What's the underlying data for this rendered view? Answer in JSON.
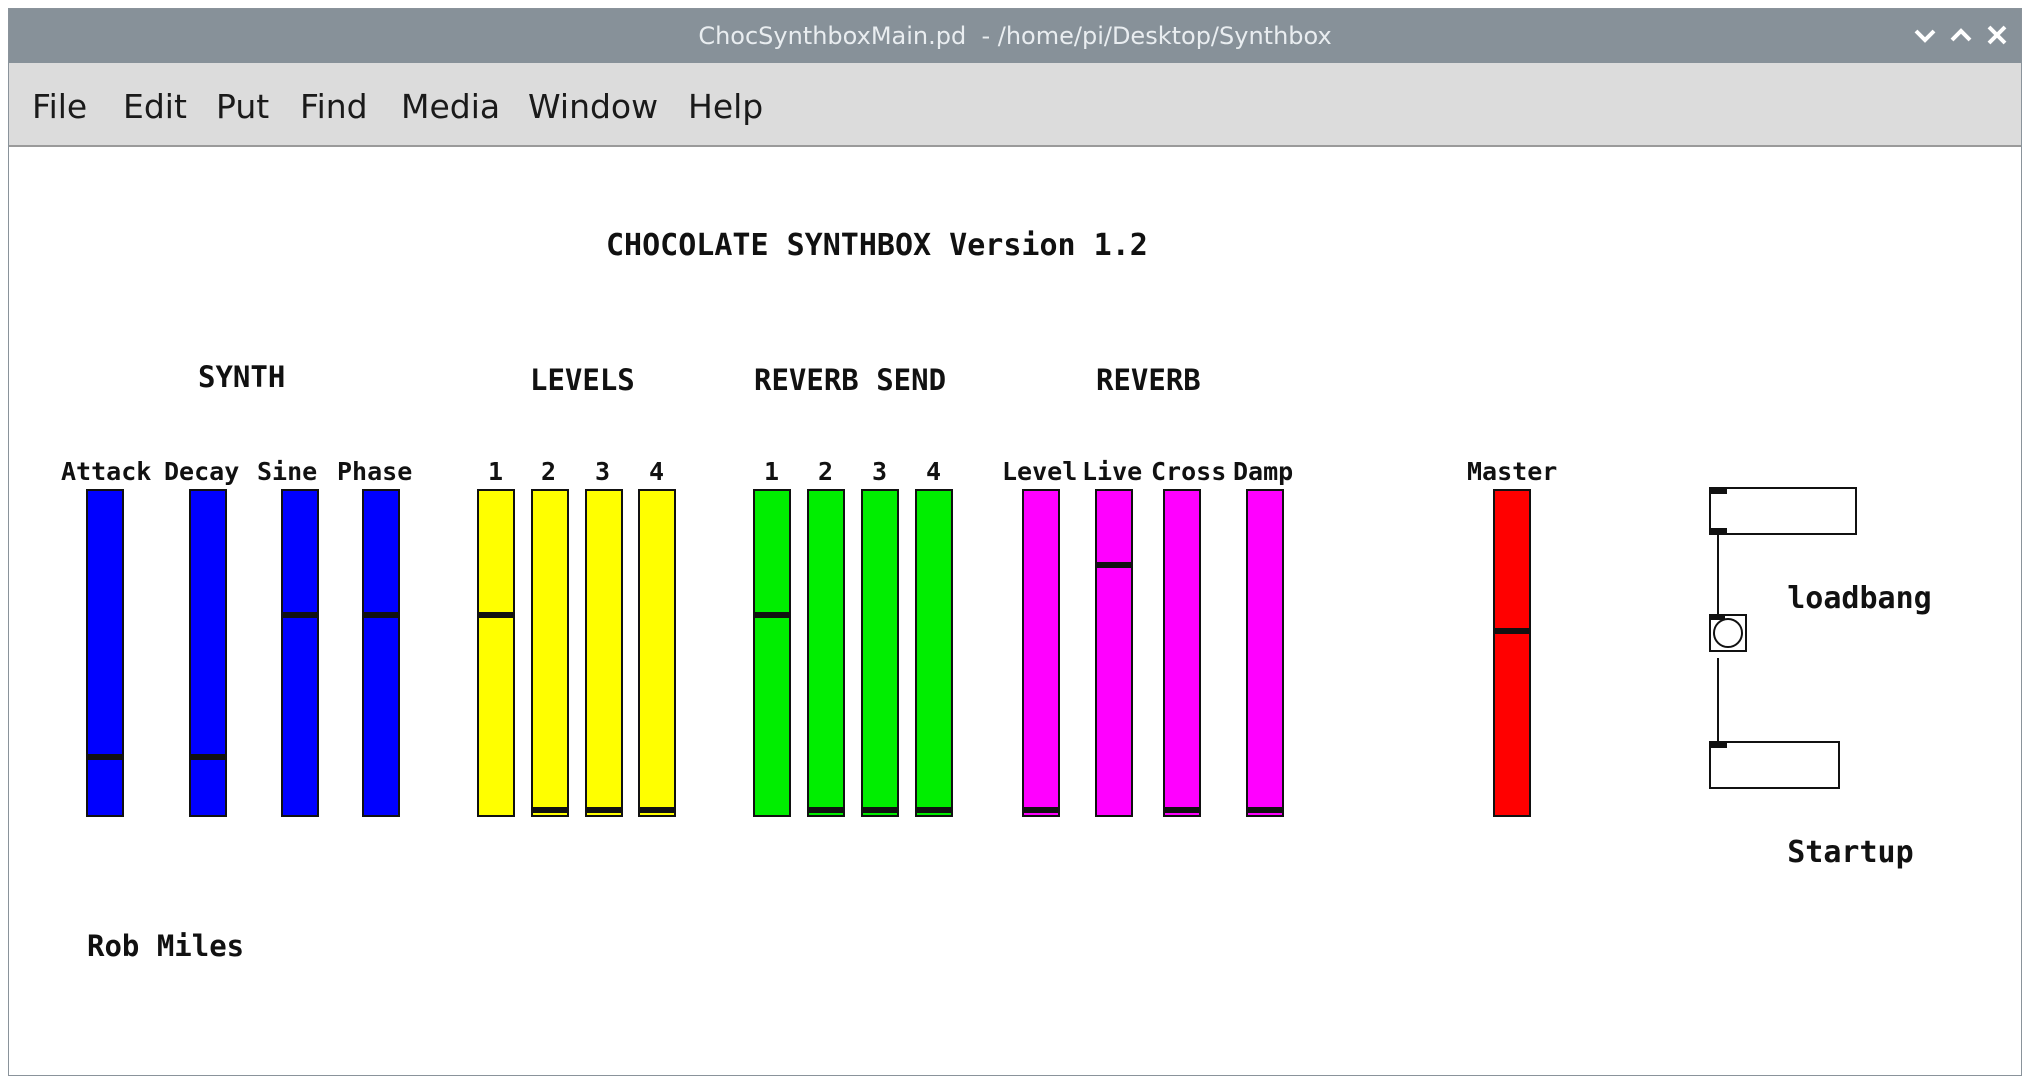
{
  "window": {
    "title": "ChocSynthboxMain.pd  - /home/pi/Desktop/Synthbox",
    "controls": [
      "chevron-down-icon",
      "chevron-up-icon",
      "close-icon"
    ],
    "titlebar_color": "#879199"
  },
  "menu": {
    "file": "File",
    "edit": "Edit",
    "put": "Put",
    "find": "Find",
    "media": "Media",
    "window": "Window",
    "help": "Help"
  },
  "patch": {
    "title": "CHOCOLATE SYNTHBOX Version 1.2",
    "author": "Rob Miles",
    "groups": {
      "synth": "SYNTH",
      "levels": "LEVELS",
      "reverb_send": "REVERB SEND",
      "reverb": "REVERB"
    },
    "sliders": {
      "attack": {
        "label": "Attack",
        "color": "#0000ff",
        "level": 0.17
      },
      "decay": {
        "label": "Decay",
        "color": "#0000ff",
        "level": 0.17
      },
      "sine": {
        "label": "Sine",
        "color": "#0000ff",
        "level": 0.62
      },
      "phase": {
        "label": "Phase",
        "color": "#0000ff",
        "level": 0.62
      },
      "level_1": {
        "label": "1",
        "color": "#ffff00",
        "level": 0.62
      },
      "level_2": {
        "label": "2",
        "color": "#ffff00",
        "level": 0.0
      },
      "level_3": {
        "label": "3",
        "color": "#ffff00",
        "level": 0.0
      },
      "level_4": {
        "label": "4",
        "color": "#ffff00",
        "level": 0.0
      },
      "send_1": {
        "label": "1",
        "color": "#00ee00",
        "level": 0.62
      },
      "send_2": {
        "label": "2",
        "color": "#00ee00",
        "level": 0.0
      },
      "send_3": {
        "label": "3",
        "color": "#00ee00",
        "level": 0.0
      },
      "send_4": {
        "label": "4",
        "color": "#00ee00",
        "level": 0.0
      },
      "reverb_level": {
        "label": "Level",
        "color": "#ff00ff",
        "level": 0.0
      },
      "reverb_live": {
        "label": "Live",
        "color": "#ff00ff",
        "level": 0.78
      },
      "reverb_cross": {
        "label": "Cross",
        "color": "#ff00ff",
        "level": 0.0
      },
      "reverb_damp": {
        "label": "Damp",
        "color": "#ff00ff",
        "level": 0.0
      },
      "master": {
        "label": "Master",
        "color": "#ff0000",
        "level": 0.57
      }
    },
    "objects": {
      "loadbang": "loadbang",
      "startup": "Startup"
    }
  }
}
